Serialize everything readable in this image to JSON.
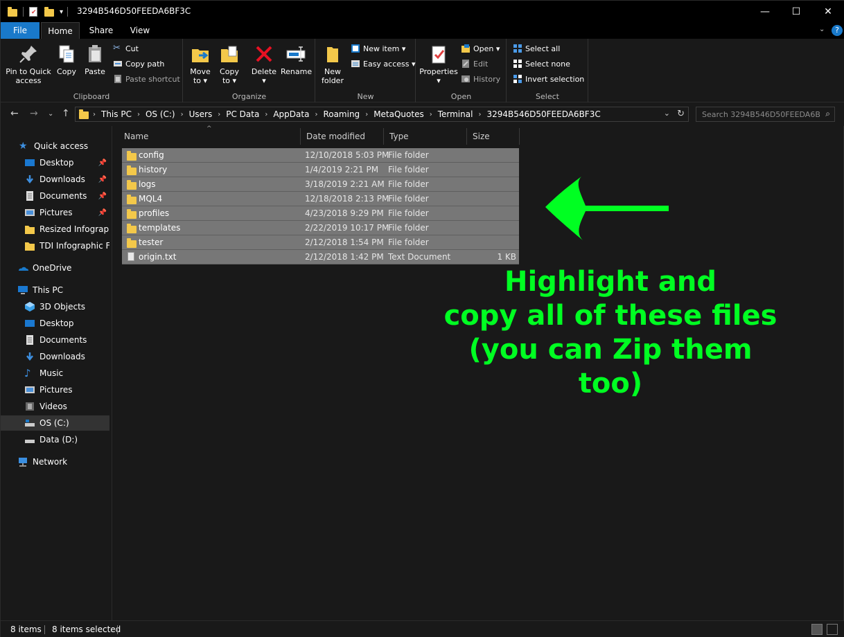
{
  "window": {
    "title": "3294B546D50FEEDA6BF3C",
    "controls": {
      "minimize": "—",
      "maximize": "☐",
      "close": "✕"
    }
  },
  "ribbon_tabs": [
    "File",
    "Home",
    "Share",
    "View"
  ],
  "ribbon": {
    "clipboard": {
      "label": "Clipboard",
      "pin": "Pin to Quick access",
      "pin_line1": "Pin to Quick",
      "pin_line2": "access",
      "copy": "Copy",
      "paste": "Paste",
      "cut": "Cut",
      "copy_path": "Copy path",
      "paste_shortcut": "Paste shortcut"
    },
    "organize": {
      "label": "Organize",
      "move_to_1": "Move",
      "move_to_2": "to ▾",
      "copy_to_1": "Copy",
      "copy_to_2": "to ▾",
      "delete_1": "Delete",
      "delete_2": "▾",
      "rename": "Rename"
    },
    "new": {
      "label": "New",
      "new_folder_1": "New",
      "new_folder_2": "folder",
      "new_item": "New item ▾",
      "easy_access": "Easy access ▾"
    },
    "open": {
      "label": "Open",
      "properties_1": "Properties",
      "properties_2": "▾",
      "open": "Open ▾",
      "edit": "Edit",
      "history": "History"
    },
    "select": {
      "label": "Select",
      "select_all": "Select all",
      "select_none": "Select none",
      "invert": "Invert selection"
    }
  },
  "address": {
    "crumbs": [
      "This PC",
      "OS (C:)",
      "Users",
      "PC Data",
      "AppData",
      "Roaming",
      "MetaQuotes",
      "Terminal",
      "3294B546D50FEEDA6BF3C"
    ],
    "search_placeholder": "Search 3294B546D50FEEDA6B..."
  },
  "nav": {
    "quick_access": "Quick access",
    "quick_items": [
      "Desktop",
      "Downloads",
      "Documents",
      "Pictures",
      "Resized Infograph",
      "TDI Infographic File"
    ],
    "onedrive": "OneDrive",
    "this_pc": "This PC",
    "pc_items": [
      "3D Objects",
      "Desktop",
      "Documents",
      "Downloads",
      "Music",
      "Pictures",
      "Videos",
      "OS (C:)",
      "Data (D:)"
    ],
    "network": "Network"
  },
  "columns": {
    "name": "Name",
    "date": "Date modified",
    "type": "Type",
    "size": "Size"
  },
  "files": [
    {
      "name": "config",
      "date": "12/10/2018 5:03 PM",
      "type": "File folder",
      "size": ""
    },
    {
      "name": "history",
      "date": "1/4/2019 2:21 PM",
      "type": "File folder",
      "size": ""
    },
    {
      "name": "logs",
      "date": "3/18/2019 2:21 AM",
      "type": "File folder",
      "size": ""
    },
    {
      "name": "MQL4",
      "date": "12/18/2018 2:13 PM",
      "type": "File folder",
      "size": ""
    },
    {
      "name": "profiles",
      "date": "4/23/2018 9:29 PM",
      "type": "File folder",
      "size": ""
    },
    {
      "name": "templates",
      "date": "2/22/2019 10:17 PM",
      "type": "File folder",
      "size": ""
    },
    {
      "name": "tester",
      "date": "2/12/2018 1:54 PM",
      "type": "File folder",
      "size": ""
    },
    {
      "name": "origin.txt",
      "date": "2/12/2018 1:42 PM",
      "type": "Text Document",
      "size": "1 KB"
    }
  ],
  "annotation": {
    "line1": "Highlight and",
    "line2": "copy all of these files",
    "line3": "(you can Zip them",
    "line4": "too)",
    "color": "#00ff22"
  },
  "status": {
    "items": "8 items",
    "selected": "8 items selected"
  },
  "colors": {
    "accent": "#1979ca",
    "folder": "#f3c84a",
    "selection": "#777777"
  }
}
